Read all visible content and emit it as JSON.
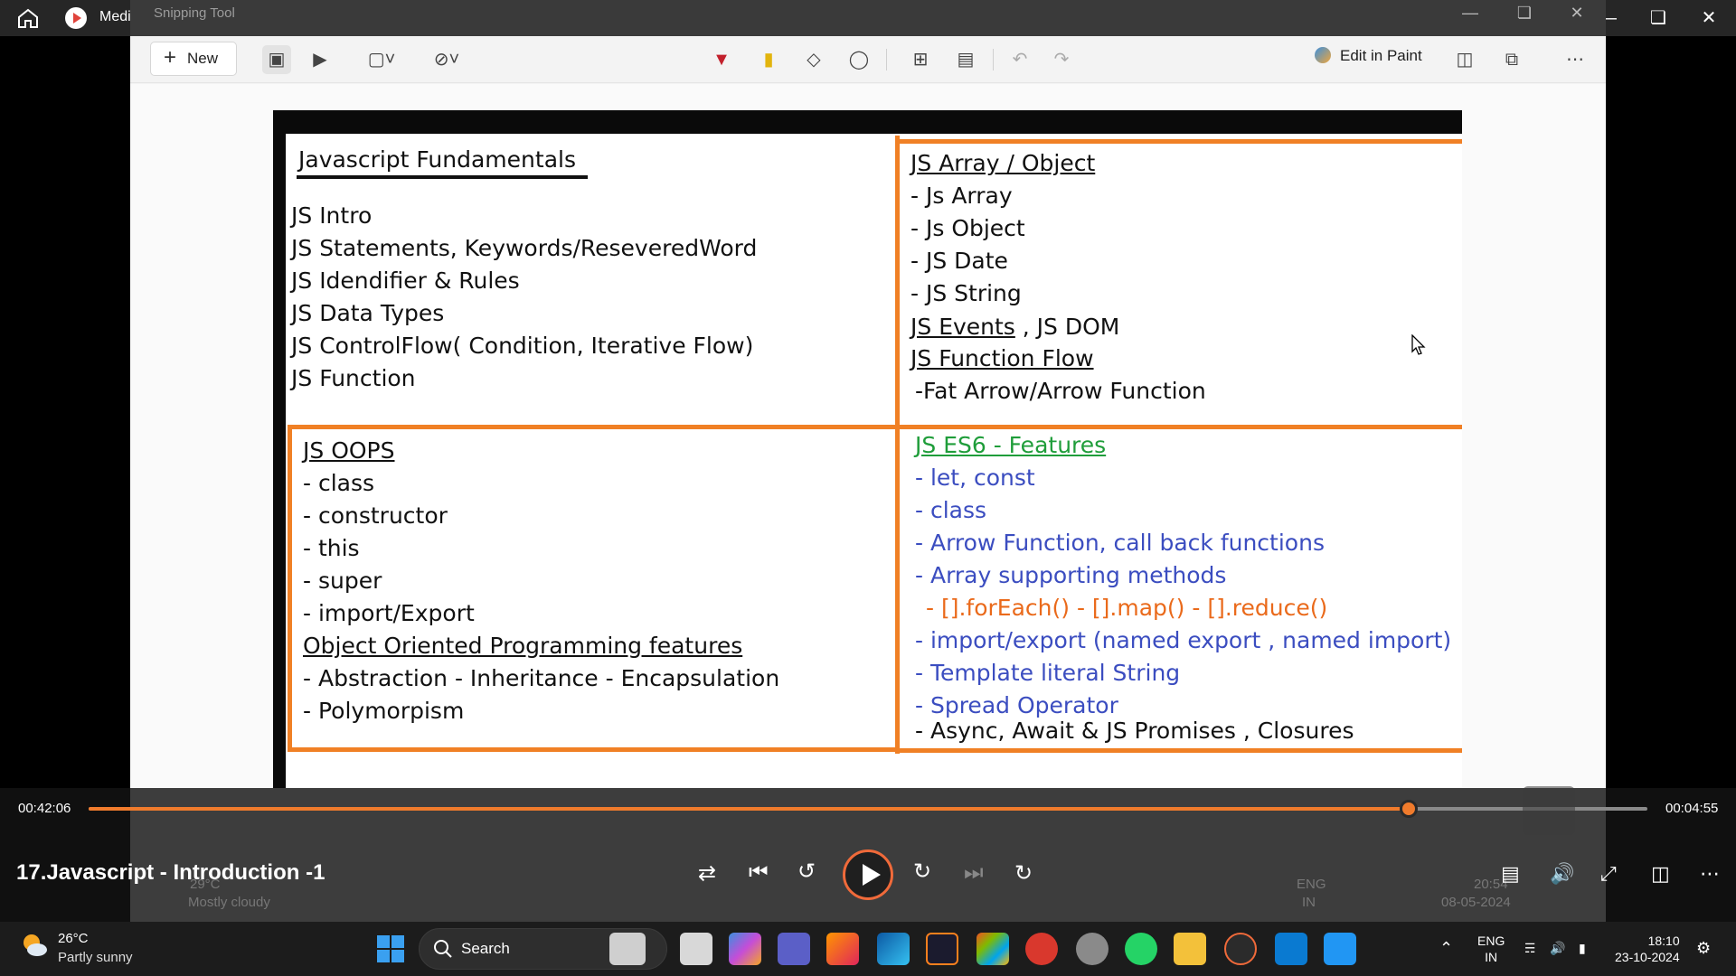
{
  "media_player": {
    "app_title": "Media Player",
    "video_title": "17.Javascript - Introduction -1",
    "time_elapsed": "00:42:06",
    "time_remaining": "00:04:55",
    "progress": 0.8468,
    "accent": "#f07b2c"
  },
  "snipping_tool": {
    "title": "Snipping Tool",
    "new_label": "New",
    "edit_in_paint_label": "Edit in Paint"
  },
  "slide": {
    "q1": {
      "heading": "Javascript Fundamentals",
      "items": [
        "JS Intro",
        "JS Statements, Keywords/ReseveredWord",
        "JS Idendifier & Rules",
        "JS Data Types",
        "JS ControlFlow( Condition, Iterative Flow)",
        "JS Function"
      ]
    },
    "q2": {
      "heading": "JS Array / Object",
      "items": [
        "- Js Array",
        "- Js Object",
        "- JS Date",
        "- JS String"
      ],
      "events": "JS Events",
      "dom": " , JS DOM",
      "function_flow": "JS Function Flow",
      "arrow": "-Fat Arrow/Arrow Function"
    },
    "q3": {
      "heading": "JS OOPS",
      "items": [
        "- class",
        "- constructor",
        "- this",
        "- super",
        "- import/Export"
      ],
      "oop_heading": "Object Oriented Programming features",
      "oop_items": [
        "- Abstraction  - Inheritance - Encapsulation",
        "- Polymorpism"
      ]
    },
    "q4": {
      "heading": "JS ES6  - Features",
      "items": [
        "- let, const",
        "- class",
        "- Arrow Function, call back functions",
        "- Array supporting methods"
      ],
      "array_methods": "- [].forEach()  - [].map()  - [].reduce()",
      "items2": [
        "- import/export (named export , named import)",
        "- Template literal String",
        "- Spread Operator"
      ],
      "last": "- Async, Await & JS Promises , Closures"
    }
  },
  "inner_video_taskbar": {
    "weather_temp": "29°C",
    "weather_desc": "Mostly cloudy",
    "lang_top": "ENG",
    "lang_bottom": "IN",
    "time": "20:54",
    "date": "08-05-2024"
  },
  "taskbar": {
    "weather_temp": "26°C",
    "weather_desc": "Partly sunny",
    "search_label": "Search",
    "lang_top": "ENG",
    "lang_bottom": "IN",
    "time": "18:10",
    "date": "23-10-2024"
  }
}
